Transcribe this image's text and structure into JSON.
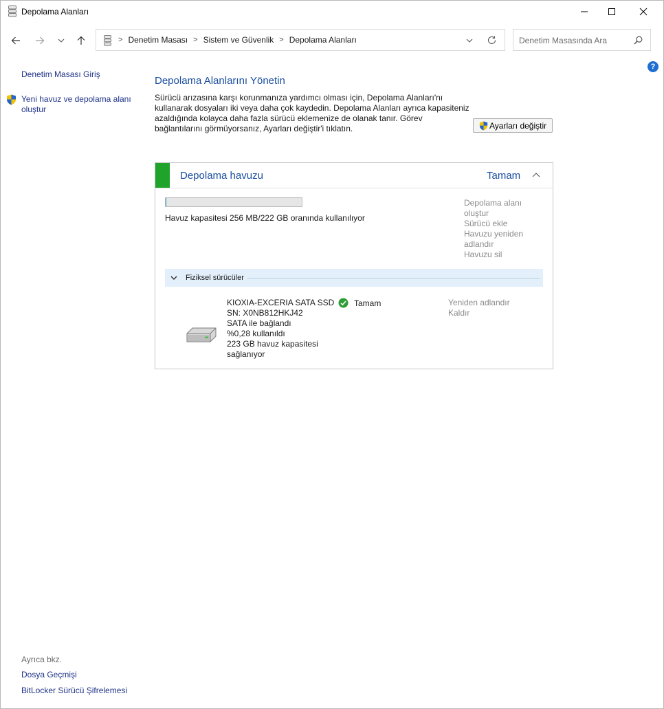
{
  "window": {
    "title": "Depolama Alanları",
    "minimize_icon": "minimize-icon",
    "maximize_icon": "maximize-icon",
    "close_icon": "close-icon"
  },
  "nav": {
    "breadcrumbs": [
      "Denetim Masası",
      "Sistem ve Güvenlik",
      "Depolama Alanları"
    ],
    "search_placeholder": "Denetim Masasında Ara"
  },
  "left_pane": {
    "home_link": "Denetim Masası Giriş",
    "create_pool_link_line1": "Yeni havuz ve depolama alanı",
    "create_pool_link_line2": "oluştur",
    "see_also": "Ayrıca bkz.",
    "file_history_link": "Dosya Geçmişi",
    "bitlocker_link": "BitLocker Sürücü Şifrelemesi"
  },
  "main": {
    "heading": "Depolama Alanlarını Yönetin",
    "description_lines": [
      "Sürücü arızasına karşı korunmanıza yardımcı olması için, Depolama Alanları'nı",
      "kullanarak dosyaları iki veya daha çok kaydedin. Depolama Alanları ayrıca kapasiteniz",
      "azaldığında kolayca daha fazla sürücü eklemenize de olanak tanır. Görev",
      "bağlantılarını görmüyorsanız, Ayarları değiştir'i tıklatın."
    ],
    "settings_button": "Ayarları değiştir"
  },
  "pool": {
    "title": "Depolama havuzu",
    "status": "Tamam",
    "usage_fraction": 0.0011,
    "usage_text": "Havuz kapasitesi 256 MB/222 GB oranında kullanılıyor",
    "actions": [
      "Depolama alanı",
      "oluştur",
      "Sürücü ekle",
      "Havuzu yeniden",
      "adlandır",
      "Havuzu sil"
    ],
    "physical_drives_label": "Fiziksel sürücüler",
    "status_color": "#1fa32a"
  },
  "drive": {
    "lines": [
      "KIOXIA-EXCERIA SATA SSD",
      "SN: X0NB812HKJ42",
      "SATA ile bağlandı",
      "%0,28 kullanıldı",
      "223 GB havuz kapasitesi",
      "sağlanıyor"
    ],
    "status": "Tamam",
    "actions": [
      "Yeniden adlandır",
      "Kaldır"
    ]
  }
}
